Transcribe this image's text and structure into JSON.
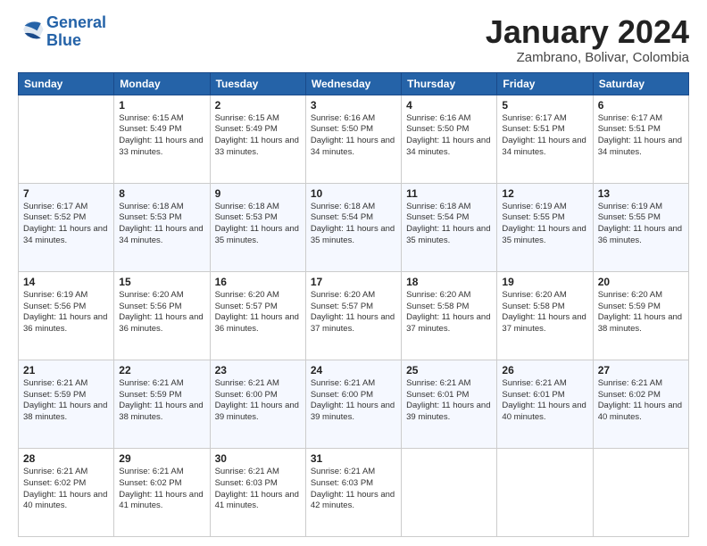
{
  "logo": {
    "line1": "General",
    "line2": "Blue"
  },
  "title": "January 2024",
  "subtitle": "Zambrano, Bolivar, Colombia",
  "days_of_week": [
    "Sunday",
    "Monday",
    "Tuesday",
    "Wednesday",
    "Thursday",
    "Friday",
    "Saturday"
  ],
  "weeks": [
    [
      {
        "day": "",
        "sunrise": "",
        "sunset": "",
        "daylight": ""
      },
      {
        "day": "1",
        "sunrise": "Sunrise: 6:15 AM",
        "sunset": "Sunset: 5:49 PM",
        "daylight": "Daylight: 11 hours and 33 minutes."
      },
      {
        "day": "2",
        "sunrise": "Sunrise: 6:15 AM",
        "sunset": "Sunset: 5:49 PM",
        "daylight": "Daylight: 11 hours and 33 minutes."
      },
      {
        "day": "3",
        "sunrise": "Sunrise: 6:16 AM",
        "sunset": "Sunset: 5:50 PM",
        "daylight": "Daylight: 11 hours and 34 minutes."
      },
      {
        "day": "4",
        "sunrise": "Sunrise: 6:16 AM",
        "sunset": "Sunset: 5:50 PM",
        "daylight": "Daylight: 11 hours and 34 minutes."
      },
      {
        "day": "5",
        "sunrise": "Sunrise: 6:17 AM",
        "sunset": "Sunset: 5:51 PM",
        "daylight": "Daylight: 11 hours and 34 minutes."
      },
      {
        "day": "6",
        "sunrise": "Sunrise: 6:17 AM",
        "sunset": "Sunset: 5:51 PM",
        "daylight": "Daylight: 11 hours and 34 minutes."
      }
    ],
    [
      {
        "day": "7",
        "sunrise": "Sunrise: 6:17 AM",
        "sunset": "Sunset: 5:52 PM",
        "daylight": "Daylight: 11 hours and 34 minutes."
      },
      {
        "day": "8",
        "sunrise": "Sunrise: 6:18 AM",
        "sunset": "Sunset: 5:53 PM",
        "daylight": "Daylight: 11 hours and 34 minutes."
      },
      {
        "day": "9",
        "sunrise": "Sunrise: 6:18 AM",
        "sunset": "Sunset: 5:53 PM",
        "daylight": "Daylight: 11 hours and 35 minutes."
      },
      {
        "day": "10",
        "sunrise": "Sunrise: 6:18 AM",
        "sunset": "Sunset: 5:54 PM",
        "daylight": "Daylight: 11 hours and 35 minutes."
      },
      {
        "day": "11",
        "sunrise": "Sunrise: 6:18 AM",
        "sunset": "Sunset: 5:54 PM",
        "daylight": "Daylight: 11 hours and 35 minutes."
      },
      {
        "day": "12",
        "sunrise": "Sunrise: 6:19 AM",
        "sunset": "Sunset: 5:55 PM",
        "daylight": "Daylight: 11 hours and 35 minutes."
      },
      {
        "day": "13",
        "sunrise": "Sunrise: 6:19 AM",
        "sunset": "Sunset: 5:55 PM",
        "daylight": "Daylight: 11 hours and 36 minutes."
      }
    ],
    [
      {
        "day": "14",
        "sunrise": "Sunrise: 6:19 AM",
        "sunset": "Sunset: 5:56 PM",
        "daylight": "Daylight: 11 hours and 36 minutes."
      },
      {
        "day": "15",
        "sunrise": "Sunrise: 6:20 AM",
        "sunset": "Sunset: 5:56 PM",
        "daylight": "Daylight: 11 hours and 36 minutes."
      },
      {
        "day": "16",
        "sunrise": "Sunrise: 6:20 AM",
        "sunset": "Sunset: 5:57 PM",
        "daylight": "Daylight: 11 hours and 36 minutes."
      },
      {
        "day": "17",
        "sunrise": "Sunrise: 6:20 AM",
        "sunset": "Sunset: 5:57 PM",
        "daylight": "Daylight: 11 hours and 37 minutes."
      },
      {
        "day": "18",
        "sunrise": "Sunrise: 6:20 AM",
        "sunset": "Sunset: 5:58 PM",
        "daylight": "Daylight: 11 hours and 37 minutes."
      },
      {
        "day": "19",
        "sunrise": "Sunrise: 6:20 AM",
        "sunset": "Sunset: 5:58 PM",
        "daylight": "Daylight: 11 hours and 37 minutes."
      },
      {
        "day": "20",
        "sunrise": "Sunrise: 6:20 AM",
        "sunset": "Sunset: 5:59 PM",
        "daylight": "Daylight: 11 hours and 38 minutes."
      }
    ],
    [
      {
        "day": "21",
        "sunrise": "Sunrise: 6:21 AM",
        "sunset": "Sunset: 5:59 PM",
        "daylight": "Daylight: 11 hours and 38 minutes."
      },
      {
        "day": "22",
        "sunrise": "Sunrise: 6:21 AM",
        "sunset": "Sunset: 5:59 PM",
        "daylight": "Daylight: 11 hours and 38 minutes."
      },
      {
        "day": "23",
        "sunrise": "Sunrise: 6:21 AM",
        "sunset": "Sunset: 6:00 PM",
        "daylight": "Daylight: 11 hours and 39 minutes."
      },
      {
        "day": "24",
        "sunrise": "Sunrise: 6:21 AM",
        "sunset": "Sunset: 6:00 PM",
        "daylight": "Daylight: 11 hours and 39 minutes."
      },
      {
        "day": "25",
        "sunrise": "Sunrise: 6:21 AM",
        "sunset": "Sunset: 6:01 PM",
        "daylight": "Daylight: 11 hours and 39 minutes."
      },
      {
        "day": "26",
        "sunrise": "Sunrise: 6:21 AM",
        "sunset": "Sunset: 6:01 PM",
        "daylight": "Daylight: 11 hours and 40 minutes."
      },
      {
        "day": "27",
        "sunrise": "Sunrise: 6:21 AM",
        "sunset": "Sunset: 6:02 PM",
        "daylight": "Daylight: 11 hours and 40 minutes."
      }
    ],
    [
      {
        "day": "28",
        "sunrise": "Sunrise: 6:21 AM",
        "sunset": "Sunset: 6:02 PM",
        "daylight": "Daylight: 11 hours and 40 minutes."
      },
      {
        "day": "29",
        "sunrise": "Sunrise: 6:21 AM",
        "sunset": "Sunset: 6:02 PM",
        "daylight": "Daylight: 11 hours and 41 minutes."
      },
      {
        "day": "30",
        "sunrise": "Sunrise: 6:21 AM",
        "sunset": "Sunset: 6:03 PM",
        "daylight": "Daylight: 11 hours and 41 minutes."
      },
      {
        "day": "31",
        "sunrise": "Sunrise: 6:21 AM",
        "sunset": "Sunset: 6:03 PM",
        "daylight": "Daylight: 11 hours and 42 minutes."
      },
      {
        "day": "",
        "sunrise": "",
        "sunset": "",
        "daylight": ""
      },
      {
        "day": "",
        "sunrise": "",
        "sunset": "",
        "daylight": ""
      },
      {
        "day": "",
        "sunrise": "",
        "sunset": "",
        "daylight": ""
      }
    ]
  ]
}
